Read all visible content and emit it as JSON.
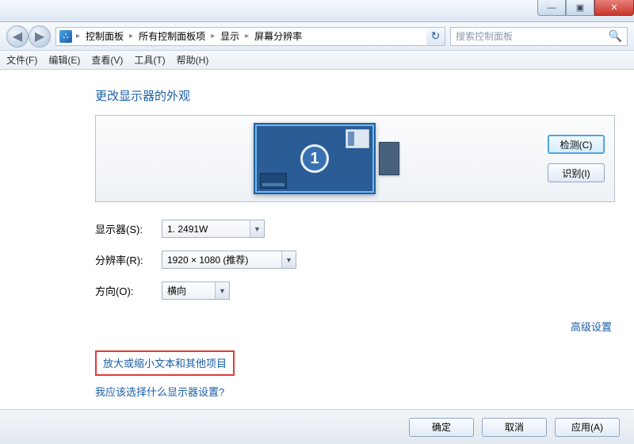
{
  "titlebar": {
    "minimize": "—",
    "maximize": "▣",
    "close": "✕"
  },
  "nav": {
    "back": "◀",
    "fwd": "▶",
    "crumbs": [
      "控制面板",
      "所有控制面板项",
      "显示",
      "屏幕分辨率"
    ],
    "refresh": "↻",
    "search_placeholder": "搜索控制面板",
    "mag": "🔍"
  },
  "menu": {
    "file": "文件(F)",
    "edit": "编辑(E)",
    "view": "查看(V)",
    "tools": "工具(T)",
    "help": "帮助(H)"
  },
  "heading": "更改显示器的外观",
  "detect_label": "检测(C)",
  "identify_label": "识别(I)",
  "monitor_number": "1",
  "fields": {
    "display_label": "显示器(S):",
    "display_value": "1. 2491W",
    "res_label": "分辨率(R):",
    "res_value": "1920 × 1080 (推荐)",
    "orient_label": "方向(O):",
    "orient_value": "横向"
  },
  "advanced_label": "高级设置",
  "links": {
    "scale": "放大或缩小文本和其他项目",
    "which": "我应该选择什么显示器设置?"
  },
  "footer": {
    "ok": "确定",
    "cancel": "取消",
    "apply": "应用(A)"
  },
  "combo_arrow": "▼"
}
